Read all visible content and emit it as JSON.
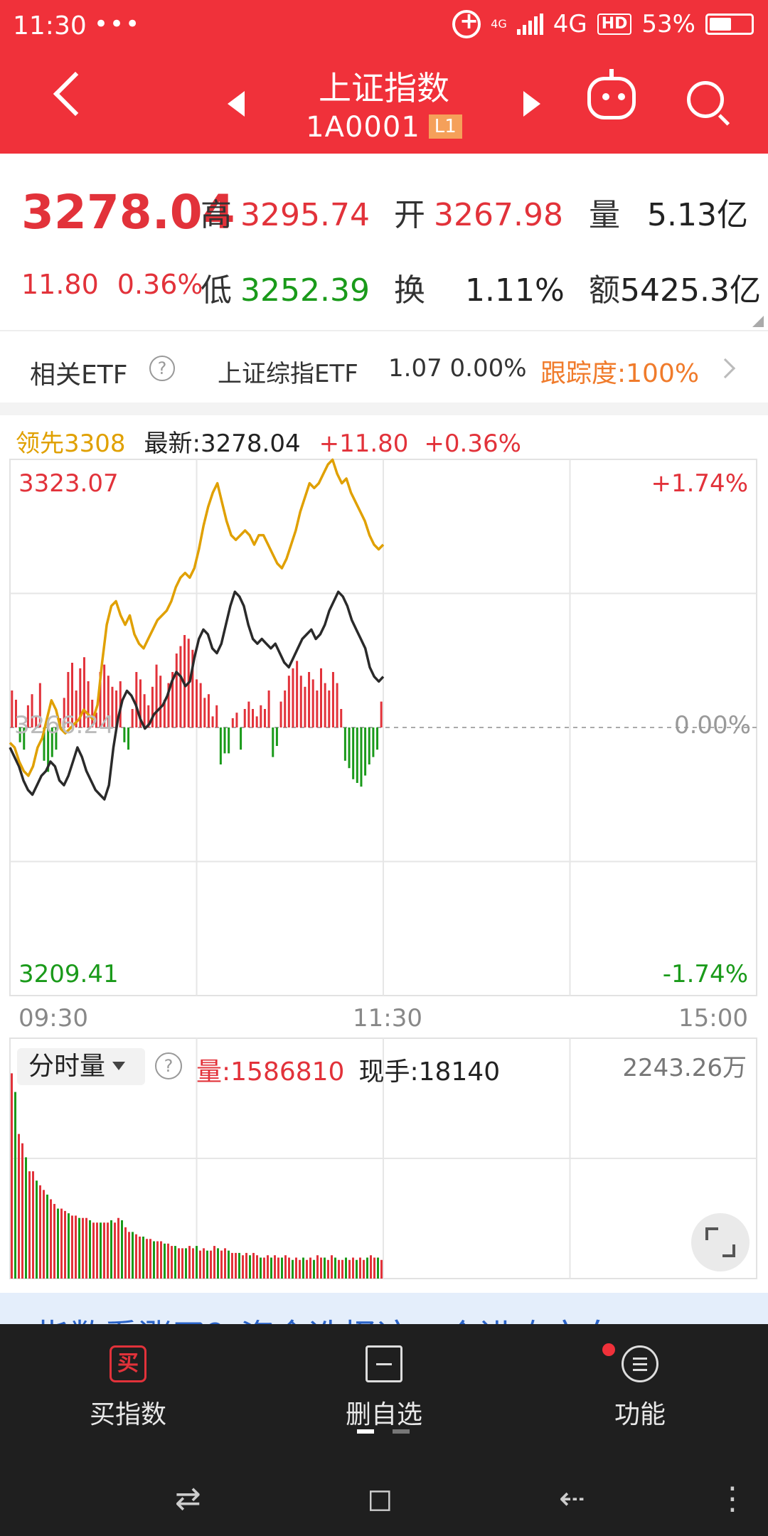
{
  "status_bar": {
    "time": "11:30",
    "dots": "•••",
    "net_small": "4G",
    "net": "4G",
    "hd": "HD",
    "battery": "53%",
    "battery_level": 0.53
  },
  "header": {
    "title": "上证指数",
    "code": "1A0001",
    "level_badge": "L1"
  },
  "quote": {
    "price": "3278.04",
    "change": "11.80",
    "change_pct": "0.36%",
    "high_label": "高",
    "high": "3295.74",
    "open_label": "开",
    "open": "3267.98",
    "volume_label": "量",
    "volume": "5.13亿",
    "low_label": "低",
    "low": "3252.39",
    "turnover_label": "换",
    "turnover": "1.11%",
    "amount_label": "额",
    "amount": "5425.3亿"
  },
  "etf": {
    "label": "相关ETF",
    "help": "?",
    "name": "上证综指ETF",
    "value": "1.07 0.00%",
    "tracking": "跟踪度:100%"
  },
  "legend": {
    "lead": "领先3308",
    "latest": "最新:3278.04",
    "change": "+11.80",
    "change_pct": "+0.36%"
  },
  "chart_data": {
    "type": "line",
    "y_left_top": "3323.07",
    "y_left_bottom": "3209.41",
    "y_right_top": "+1.74%",
    "y_right_bottom": "-1.74%",
    "mid_right": "0.00%",
    "mid_left": "3266.24",
    "x_ticks": [
      "09:30",
      "11:30",
      "15:00"
    ],
    "ylim": [
      3209.41,
      3323.07
    ],
    "prev_close": 3266.24,
    "series": [
      {
        "color": "#2a2a2a",
        "values": [
          3262,
          3260,
          3258,
          3255,
          3253,
          3252,
          3254,
          3256,
          3257,
          3259,
          3258,
          3255,
          3254,
          3256,
          3259,
          3262,
          3260,
          3257,
          3255,
          3253,
          3252,
          3251,
          3254,
          3262,
          3268,
          3272,
          3274,
          3273,
          3271,
          3268,
          3266,
          3267,
          3269,
          3270,
          3271,
          3273,
          3276,
          3278,
          3277,
          3275,
          3276,
          3281,
          3285,
          3287,
          3286,
          3283,
          3282,
          3284,
          3288,
          3292,
          3295,
          3294,
          3292,
          3288,
          3285,
          3284,
          3285,
          3284,
          3283,
          3284,
          3282,
          3280,
          3279,
          3281,
          3283,
          3285,
          3286,
          3287,
          3285,
          3286,
          3288,
          3291,
          3293,
          3295,
          3294,
          3292,
          3289,
          3287,
          3285,
          3283,
          3279,
          3277,
          3276,
          3277
        ]
      },
      {
        "color": "#e0a000",
        "values": [
          3263,
          3262,
          3259,
          3257,
          3256,
          3258,
          3262,
          3264,
          3268,
          3272,
          3270,
          3266,
          3265,
          3266,
          3267,
          3268,
          3270,
          3269,
          3268,
          3271,
          3280,
          3288,
          3292,
          3293,
          3290,
          3288,
          3290,
          3286,
          3284,
          3283,
          3285,
          3287,
          3289,
          3290,
          3291,
          3293,
          3296,
          3298,
          3299,
          3298,
          3300,
          3304,
          3309,
          3313,
          3316,
          3318,
          3314,
          3310,
          3307,
          3306,
          3307,
          3308,
          3307,
          3305,
          3307,
          3307,
          3305,
          3303,
          3301,
          3300,
          3302,
          3305,
          3308,
          3312,
          3315,
          3318,
          3317,
          3318,
          3320,
          3322,
          3323,
          3320,
          3318,
          3319,
          3316,
          3314,
          3312,
          3310,
          3307,
          3305,
          3304,
          3305
        ]
      }
    ],
    "histogram": [
      20,
      15,
      -8,
      -12,
      12,
      18,
      6,
      24,
      -18,
      -24,
      -16,
      -12,
      5,
      16,
      30,
      35,
      20,
      32,
      38,
      25,
      15,
      8,
      30,
      34,
      28,
      22,
      20,
      25,
      -8,
      -12,
      10,
      30,
      26,
      18,
      12,
      22,
      34,
      28,
      15,
      24,
      30,
      40,
      44,
      50,
      48,
      42,
      26,
      24,
      16,
      18,
      6,
      12,
      -20,
      -14,
      -14,
      5,
      8,
      -12,
      10,
      14,
      10,
      6,
      12,
      10,
      20,
      -16,
      -10,
      14,
      20,
      28,
      32,
      36,
      28,
      22,
      30,
      26,
      20,
      32,
      24,
      20,
      30,
      24,
      10,
      -18,
      -22,
      -28,
      -30,
      -32,
      -26,
      -20,
      -16,
      -12,
      14
    ],
    "volume_bars": [
      88,
      80,
      62,
      58,
      52,
      46,
      46,
      42,
      40,
      38,
      36,
      34,
      32,
      30,
      30,
      29,
      28,
      27,
      27,
      26,
      26,
      26,
      25,
      24,
      24,
      24,
      24,
      24,
      25,
      24,
      26,
      25,
      22,
      20,
      20,
      19,
      18,
      18,
      17,
      17,
      16,
      16,
      16,
      15,
      15,
      14,
      14,
      13,
      13,
      13,
      14,
      13,
      14,
      12,
      13,
      12,
      12,
      14,
      13,
      12,
      13,
      12,
      11,
      11,
      11,
      10,
      11,
      10,
      11,
      10,
      9,
      9,
      10,
      9,
      10,
      9,
      9,
      10,
      9,
      8,
      9,
      8,
      9,
      8,
      9,
      8,
      10,
      9,
      9,
      8,
      10,
      9,
      8,
      8,
      9,
      8,
      9,
      8,
      9,
      8,
      9,
      10,
      9,
      9,
      8
    ]
  },
  "volume": {
    "selector": "分时量",
    "help": "?",
    "vol": "量:1586810",
    "hand": "现手:18140",
    "max": "2243.26万"
  },
  "banner": {
    "text": "指数看涨了？资金选择这一个进攻方向"
  },
  "toolbar": {
    "buy_icon": "买",
    "buy": "买指数",
    "delete": "删自选",
    "function": "功能"
  },
  "sysnav": {
    "switch": "⇄",
    "home": "◻",
    "back": "⇠",
    "menu": "⋮"
  }
}
